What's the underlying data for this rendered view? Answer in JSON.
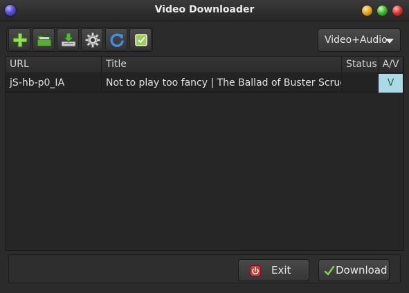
{
  "window": {
    "title": "Video Downloader"
  },
  "toolbar": {
    "buttons": [
      {
        "icon": "add-icon"
      },
      {
        "icon": "open-folder-icon"
      },
      {
        "icon": "download-tray-icon"
      },
      {
        "icon": "gear-icon"
      },
      {
        "icon": "refresh-icon"
      },
      {
        "icon": "checkbox-icon"
      }
    ],
    "mode_select": {
      "value": "Video+Audio"
    }
  },
  "table": {
    "columns": [
      "URL",
      "Title",
      "Status",
      "A/V"
    ],
    "rows": [
      {
        "url": "jS-hb-p0_IA",
        "title": "Not to play too fancy | The Ballad of Buster Scrugg",
        "status": "",
        "av": "V"
      }
    ]
  },
  "buttons": {
    "exit": "Exit",
    "download": "Download"
  },
  "colors": {
    "av_cell_bg": "#add8e6",
    "av_text": "#2a6a2a"
  }
}
